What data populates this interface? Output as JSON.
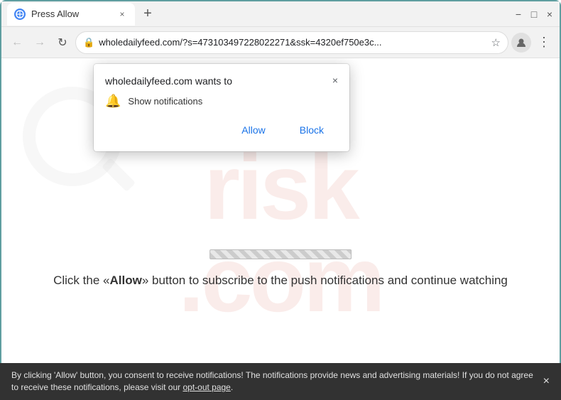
{
  "titlebar": {
    "tab_title": "Press Allow",
    "tab_close": "×",
    "new_tab": "+",
    "window_minimize": "−",
    "window_maximize": "□",
    "window_close": "×"
  },
  "omnibar": {
    "back_icon": "←",
    "forward_icon": "→",
    "reload_icon": "↻",
    "url": "wholedailyfeed.com/?s=473103497228022271&ssk=4320ef750e3c...",
    "star_icon": "☆",
    "profile_icon": "👤",
    "menu_icon": "⋮"
  },
  "popup": {
    "title": "wholedailyfeed.com wants to",
    "close_icon": "×",
    "notification_label": "Show notifications",
    "allow_label": "Allow",
    "block_label": "Block"
  },
  "page": {
    "progress_visible": true,
    "click_text_before": "Click the «",
    "click_text_bold": "Allow",
    "click_text_after": "» button to subscribe to the push notifications and continue watching",
    "watermark_text": "risk.com"
  },
  "bottom_bar": {
    "message": "By clicking 'Allow' button, you consent to receive notifications! The notifications provide news and advertising materials! If you do not agree to receive these notifications, please visit our ",
    "link_text": "opt-out page",
    "link_suffix": ".",
    "close_icon": "×"
  }
}
